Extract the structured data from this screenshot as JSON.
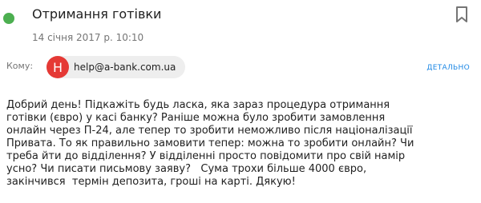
{
  "header": {
    "subject": "Отримання готівки",
    "date": "14 січня 2017 р. 10:10"
  },
  "recipients": {
    "to_label": "Кому:",
    "avatar_letter": "H",
    "email": "help@a-bank.com.ua",
    "details_link": "ДЕТАЛЬНО"
  },
  "message": {
    "lines": [
      "Добрий день! Підкажіть будь ласка, яка зараз процедура отримання",
      "готівки (євро) у касі банку? Раніше можна було зробити замовлення",
      "онлайн через П-24, але тепер то зробити неможливо після націоналізації",
      "Привата. То як правильно замовити тепер: можна то зробити онлайн? Чи",
      "треба йти до відділення? У відділенні просто повідомити про свій намір",
      "усно? Чи писати письмову заяву?   Сума трохи більше 4000 євро,",
      "закінчився  термін депозита, гроші на карті. Дякую!"
    ]
  },
  "colors": {
    "status_dot": "#4caf50",
    "avatar_bg": "#e53935",
    "link": "#1e88e5",
    "chip_bg": "#eeeeee"
  },
  "icons": {
    "bookmark": "bookmark-icon"
  }
}
